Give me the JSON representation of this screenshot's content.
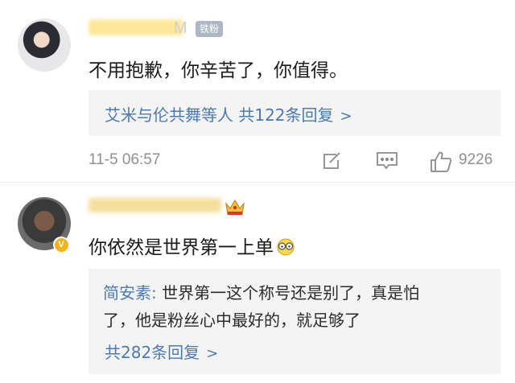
{
  "comments": [
    {
      "username_visible_suffix": "M",
      "fan_badge": "铁粉",
      "text": "不用抱歉，你辛苦了，你值得。",
      "reply_summary": {
        "names": "艾米与伦共舞等人",
        "count_label": "共122条回复",
        "chevron": ">"
      },
      "time": "11-5 06:57",
      "like_count": "9226",
      "icons": [
        "share-icon",
        "comment-icon",
        "like-icon"
      ]
    },
    {
      "verified_badge": "V",
      "text": "你依然是世界第一上单",
      "emoji": "glasses-emoji",
      "reply": {
        "author": "简安素:",
        "line1_text": " 世界第一这个称号还是别了，真是怕",
        "line2_text": "了，他是粉丝心中最好的，就足够了"
      },
      "reply_count_label": "共282条回复",
      "chevron": ">"
    }
  ],
  "colors": {
    "link_blue": "#4b7ab0",
    "meta_gray": "#8f8f8f",
    "reply_bg": "#f4f4f4",
    "fan_badge_bg": "#aeb8c4",
    "verified_gold": "#f6b21d"
  }
}
